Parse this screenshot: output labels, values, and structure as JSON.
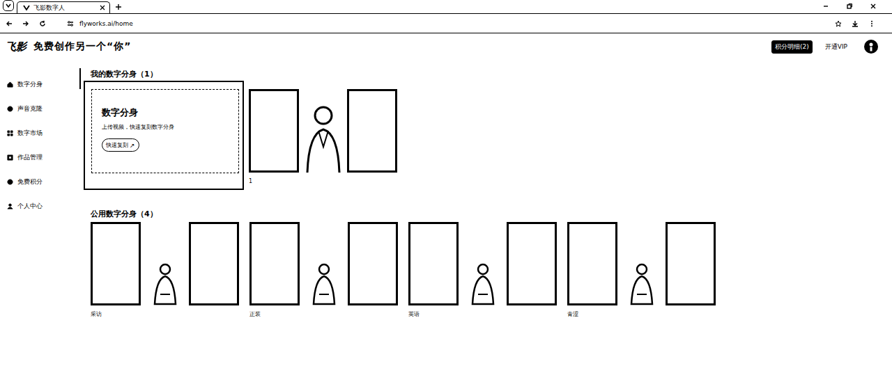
{
  "browser": {
    "tab_title": "飞影数字人",
    "url": "flyworks.ai/home"
  },
  "header": {
    "logo": "飞影",
    "slogan": "免费创作另一个“你”",
    "points_button": "积分明细(2)",
    "vip": "开通VIP"
  },
  "sidebar": {
    "items": [
      {
        "label": "数字分身"
      },
      {
        "label": "声音克隆"
      },
      {
        "label": "数字市场"
      },
      {
        "label": "作品管理"
      },
      {
        "label": "免费积分"
      },
      {
        "label": "个人中心"
      }
    ]
  },
  "my_avatars": {
    "title": "我的数字分身（1）",
    "create_card": {
      "title": "数字分身",
      "subtitle": "上传视频，快速复刻数字分身",
      "button": "快速复刻",
      "button_icon": "↗"
    },
    "items": [
      {
        "name": "1"
      }
    ]
  },
  "public_avatars": {
    "title": "公用数字分身（4）",
    "items": [
      {
        "name": "采访"
      },
      {
        "name": "正装"
      },
      {
        "name": "英语"
      },
      {
        "name": "青涩"
      }
    ]
  }
}
